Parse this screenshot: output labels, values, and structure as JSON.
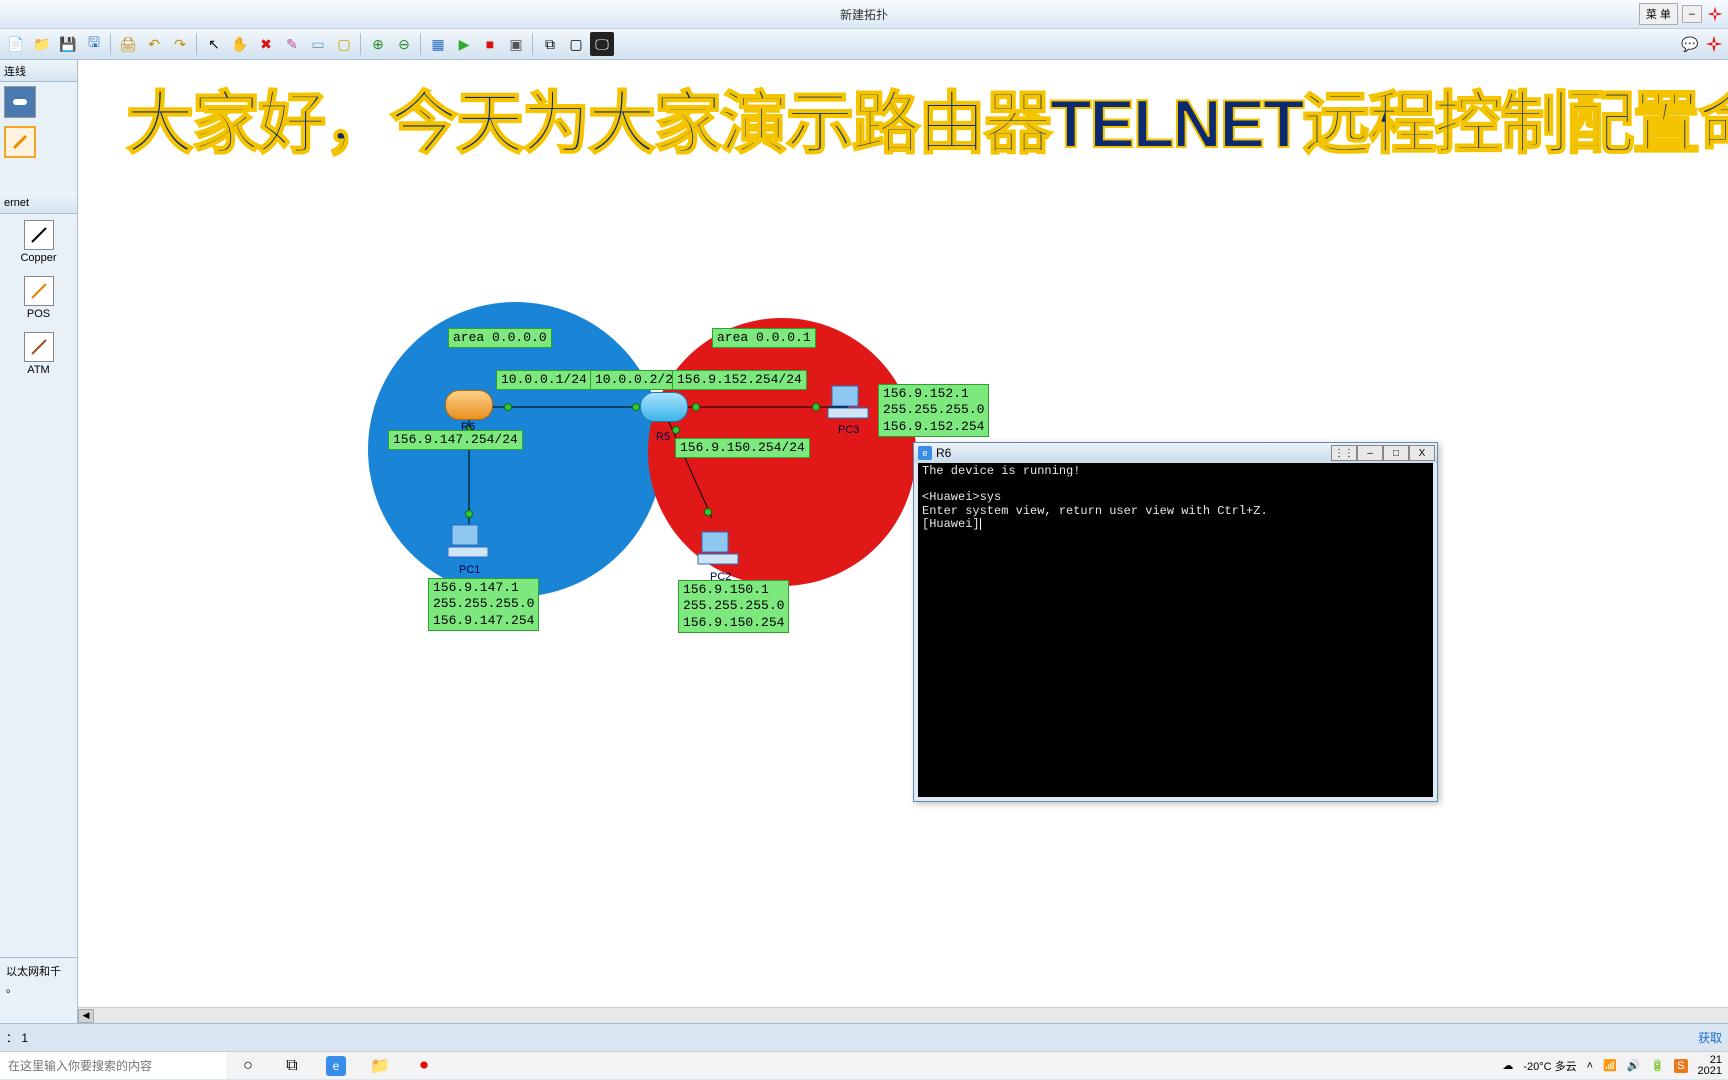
{
  "titlebar": {
    "title": "新建拓扑",
    "menu": "菜 单",
    "min": "–"
  },
  "leftpanel": {
    "header": "连线",
    "ethernet": "ernet",
    "items": [
      "Copper",
      "POS",
      "ATM"
    ],
    "desc": "以太网和千\n。"
  },
  "overlay": "大家好，今天为大家演示路由器TELNET远程控制配置命令",
  "labels": {
    "area0": "area 0.0.0.0",
    "area1": "area 0.0.0.1",
    "ip1": "10.0.0.1/24",
    "ip2": "10.0.0.2/24",
    "ip3": "156.9.152.254/24",
    "ip4": "156.9.147.254/24",
    "ip5": "156.9.150.254/24",
    "pc1": "156.9.147.1\n255.255.255.0\n156.9.147.254",
    "pc2": "156.9.150.1\n255.255.255.0\n156.9.150.254",
    "pc3": "156.9.152.1\n255.255.255.0\n156.9.152.254"
  },
  "devices": {
    "r6": "R6",
    "r5": "R5",
    "pc1": "PC1",
    "pc2": "PC2",
    "pc3": "PC3"
  },
  "cli": {
    "title": "R6",
    "body": "The device is running!\n\n<Huawei>sys\nEnter system view, return user view with Ctrl+Z.\n[Huawei]"
  },
  "status": {
    "left": "： 1",
    "right": "获取"
  },
  "taskbar": {
    "search_placeholder": "在这里输入你要搜索的内容",
    "weather": "-20°C 多云",
    "time": "21",
    "date": "2021"
  }
}
